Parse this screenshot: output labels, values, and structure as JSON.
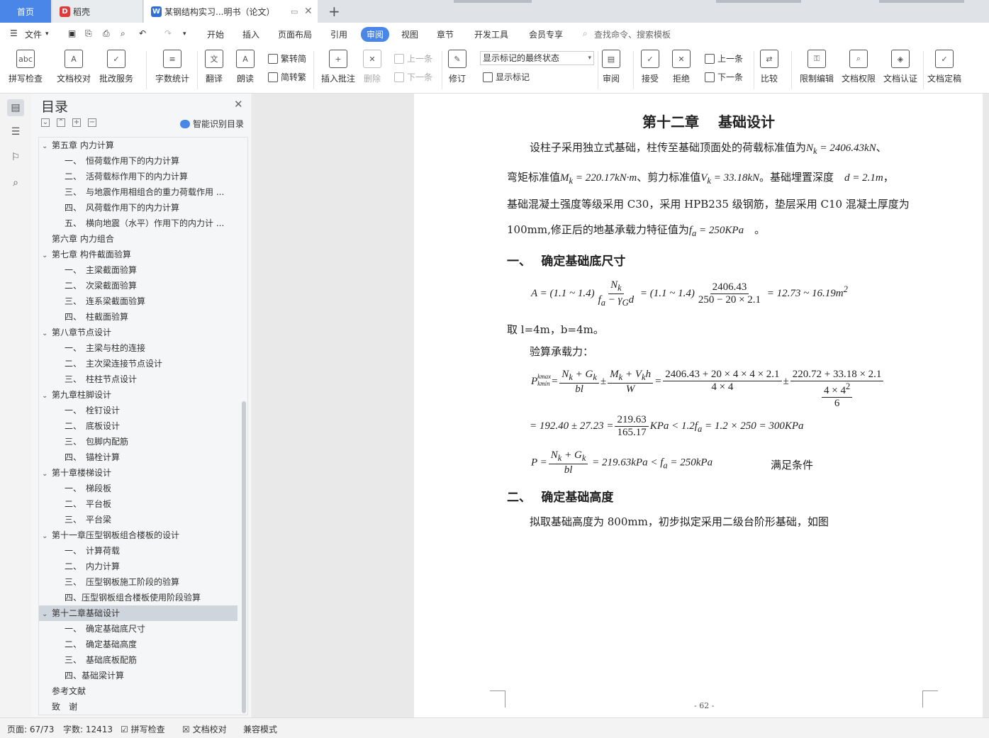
{
  "tabs": {
    "home": "首页",
    "daoke": "稻壳",
    "doc": "某钢结构实习...明书（论文）"
  },
  "menu": {
    "file": "文件",
    "items": [
      "开始",
      "插入",
      "页面布局",
      "引用",
      "审阅",
      "视图",
      "章节",
      "开发工具",
      "会员专享"
    ],
    "active": "审阅",
    "search": "查找命令、搜索模板"
  },
  "ribbon": {
    "spell": "拼写检查",
    "proof": "文档校对",
    "batch": "批改服务",
    "count": "字数统计",
    "translate": "翻译",
    "read": "朗读",
    "s2t": "繁转简",
    "t2s": "简转繁",
    "insert_comment": "插入批注",
    "delete": "删除",
    "prev": "上一条",
    "next": "下一条",
    "revise": "修订",
    "markup_state": "显示标记的最终状态",
    "show_markup": "显示标记",
    "review": "审阅",
    "accept": "接受",
    "reject": "拒绝",
    "prev2": "上一条",
    "next2": "下一条",
    "compare": "比较",
    "restrict": "限制编辑",
    "rights": "文档权限",
    "cert": "文档认证",
    "final": "文档定稿"
  },
  "toc": {
    "title": "目录",
    "smart": "智能识别目录",
    "items": [
      {
        "label": "第五章 内力计算",
        "level": 0,
        "chev": true
      },
      {
        "label": "一、　恒荷载作用下的内力计算",
        "level": 1
      },
      {
        "label": "二、　活荷载标作用下的内力计算",
        "level": 1
      },
      {
        "label": "三、　与地震作用相组合的重力荷载作用 ...",
        "level": 1
      },
      {
        "label": "四、　风荷载作用下的内力计算",
        "level": 1
      },
      {
        "label": "五、　横向地震（水平）作用下的内力计 ...",
        "level": 1
      },
      {
        "label": "第六章 内力组合",
        "level": 0,
        "chev": false
      },
      {
        "label": "第七章 构件截面验算",
        "level": 0,
        "chev": true
      },
      {
        "label": "一、　主梁截面验算",
        "level": 1
      },
      {
        "label": "二、　次梁截面验算",
        "level": 1
      },
      {
        "label": "三、　连系梁截面验算",
        "level": 1
      },
      {
        "label": "四、　柱截面验算",
        "level": 1
      },
      {
        "label": "第八章节点设计",
        "level": 0,
        "chev": true
      },
      {
        "label": "一、　主梁与柱的连接",
        "level": 1
      },
      {
        "label": "二、　主次梁连接节点设计",
        "level": 1
      },
      {
        "label": "三、　柱柱节点设计",
        "level": 1
      },
      {
        "label": "第九章柱脚设计",
        "level": 0,
        "chev": true
      },
      {
        "label": "一、　栓钉设计",
        "level": 1
      },
      {
        "label": "二、　底板设计",
        "level": 1
      },
      {
        "label": "三、　包脚内配筋",
        "level": 1
      },
      {
        "label": "四、　锚栓计算",
        "level": 1
      },
      {
        "label": "第十章楼梯设计",
        "level": 0,
        "chev": true
      },
      {
        "label": "一、　梯段板",
        "level": 1
      },
      {
        "label": "二、　平台板",
        "level": 1
      },
      {
        "label": "三、　平台梁",
        "level": 1
      },
      {
        "label": "第十一章压型钢板组合楼板的设计",
        "level": 0,
        "chev": true
      },
      {
        "label": "一、　计算荷载",
        "level": 1
      },
      {
        "label": "二、　内力计算",
        "level": 1
      },
      {
        "label": "三、　压型钢板施工阶段的验算",
        "level": 1
      },
      {
        "label": "四、压型钢板组合楼板使用阶段验算",
        "level": 1
      },
      {
        "label": "第十二章基础设计",
        "level": 0,
        "chev": true,
        "selected": true
      },
      {
        "label": "一、　确定基础底尺寸",
        "level": 1
      },
      {
        "label": "二、　确定基础高度",
        "level": 1
      },
      {
        "label": "三、　基础底板配筋",
        "level": 1
      },
      {
        "label": "四、基础梁计算",
        "level": 1
      },
      {
        "label": "参考文献",
        "level": 0,
        "chev": false
      },
      {
        "label": "致　谢",
        "level": 0,
        "chev": false
      }
    ]
  },
  "doc": {
    "chapter": "第十二章　 基础设计",
    "para1a": "设柱子采用独立式基础，柱传至基础顶面处的荷载标准值为",
    "nk": "N",
    "nk_sub": "k",
    "nk_val": " = 2406.43kN",
    "para1b": "、",
    "para2a": "弯矩标准值",
    "mk": "M",
    "mk_val": " = 220.17kN·m",
    "para2b": "、剪力标准值",
    "vk": "V",
    "vk_val": " = 33.18kN",
    "para2c": "。基础埋置深度",
    "d_val": "d = 2.1m",
    "para2d": "，",
    "para3": "基础混凝土强度等级采用 C30，采用 HPB235 级钢筋，垫层采用 C10 混凝土厚度为",
    "para4a": "100mm,修正后的地基承载力特征值为",
    "fa": "f",
    "fa_sub": "a",
    "fa_val": " = 250KPa",
    "para4b": "。",
    "sec1": "一、　 确定基础底尺寸",
    "eq1_lhs": "A = (1.1 ~ 1.4)",
    "eq1_num": "N",
    "eq1_num_sub": "k",
    "eq1_den": "f",
    "eq1_den_rest": " − γ",
    "eq1_den_G": "G",
    "eq1_den_d": "d",
    "eq1_mid": " = (1.1 ~ 1.4)",
    "eq1_n2": "2406.43",
    "eq1_d2": "250 − 20 × 2.1",
    "eq1_res": " = 12.73 ~ 16.19",
    "eq1_unit": "m",
    "eq1_sup": "2",
    "take": "取 l=4m，b=4m。",
    "check": "验算承载力：",
    "eq2_lhs": "P",
    "eq2_sup": "kmax",
    "eq2_sub": "kmin",
    "eq2_n1": "N",
    "eq2_n1b": " + G",
    "eq2_d1": "bl",
    "eq2_pm": " ± ",
    "eq2_n2": "M",
    "eq2_n2b": " + V",
    "eq2_n2c": "h",
    "eq2_d2": "W",
    "eq2_n3": "2406.43 + 20 × 4 × 4 × 2.1",
    "eq2_d3": "4 × 4",
    "eq2_n4": "220.72 + 33.18 × 2.1",
    "eq2_d4a": "4 × 4",
    "eq2_d4sup": "2",
    "eq2_d4b": "6",
    "eq3_a": "= 192.40 ± 27.23 =",
    "eq3_n": "219.63",
    "eq3_d": "165.17",
    "eq3_b": "KPa < 1.2",
    "eq3_c": " = 1.2 × 250 = 300KPa",
    "eq4_a": "P =",
    "eq4_n": "N",
    "eq4_nb": " + G",
    "eq4_d": "bl",
    "eq4_b": " = 219.63kPa < ",
    "eq4_c": " = 250kPa",
    "ok": "满足条件",
    "sec2": "二、　 确定基础高度",
    "para5": "拟取基础高度为 800mm，初步拟定采用二级台阶形基础，如图",
    "page_no": "- 62 -"
  },
  "status": {
    "page": "页面: 67/73",
    "words": "字数: 12413",
    "spell": "拼写检查",
    "proof": "文档校对",
    "compat": "兼容模式"
  }
}
